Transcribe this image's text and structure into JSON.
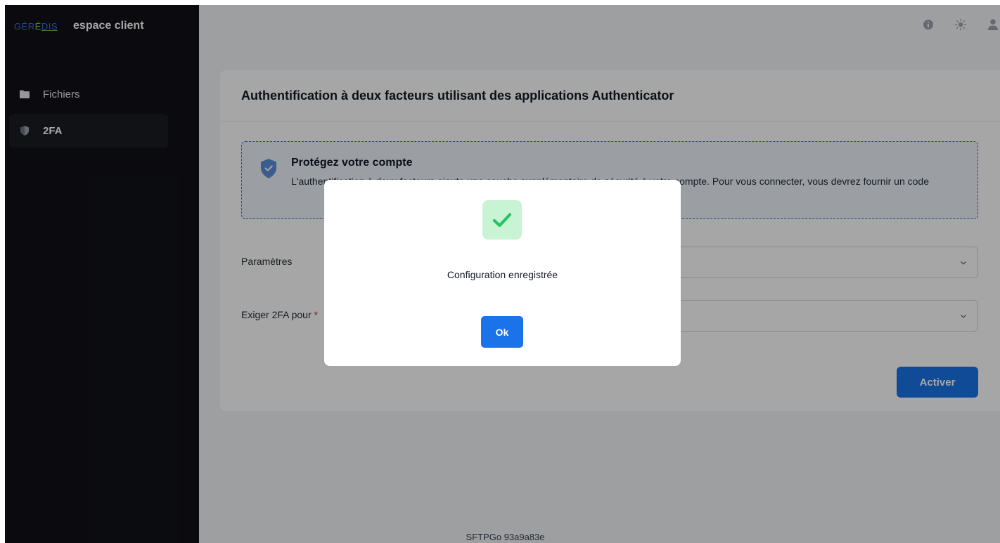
{
  "brand": {
    "logo_ge": "GÉR",
    "logo_e": "É",
    "logo_dis": "DIS",
    "app_name": "espace client"
  },
  "sidebar": {
    "items": [
      {
        "label": "Fichiers",
        "icon": "folder-icon",
        "active": false
      },
      {
        "label": "2FA",
        "icon": "shield-icon",
        "active": true
      }
    ]
  },
  "topbar": {
    "icons": [
      "info-icon",
      "sun-icon",
      "user-icon"
    ]
  },
  "card": {
    "title": "Authentification à deux facteurs utilisant des applications Authenticator",
    "notice": {
      "title": "Protégez votre compte",
      "text": "L'authentification à deux facteurs ajoute une couche supplémentaire de sécurité à votre compte. Pour vous connecter, vous devrez fournir un code"
    },
    "fields": [
      {
        "label": "Paramètres",
        "required": false
      },
      {
        "label": "Exiger 2FA pour ",
        "required": true,
        "required_mark": "*"
      }
    ],
    "activate_label": "Activer"
  },
  "footer": {
    "version": "SFTPGo 93a9a83e"
  },
  "modal": {
    "message": "Configuration enregistrée",
    "ok_label": "Ok"
  },
  "colors": {
    "accent": "#1a73e8",
    "sidebar_bg": "#111217",
    "success": "#22c55e",
    "success_bg": "#c9f3d5"
  }
}
